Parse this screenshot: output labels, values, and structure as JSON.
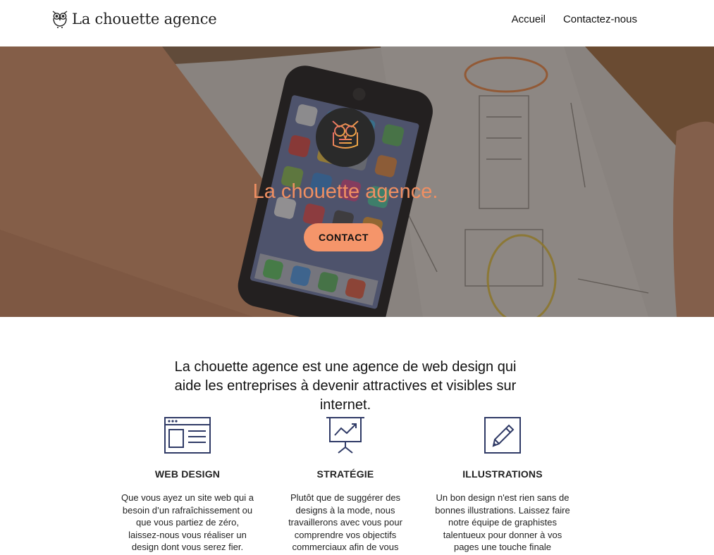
{
  "header": {
    "brand": "La chouette agence",
    "nav": [
      "Accueil",
      "Contactez-nous"
    ]
  },
  "hero": {
    "title": "La chouette agence.",
    "cta": "CONTACT"
  },
  "intro": {
    "text": "La chouette agence est une agence de web design qui aide les entreprises à devenir attractives et visibles sur internet."
  },
  "services": [
    {
      "icon": "web-design-icon",
      "title": "WEB DESIGN",
      "text": "Que vous ayez un site web qui a besoin d’un rafraîchissement ou que vous partiez de zéro, laissez-nous vous réaliser un design dont vous serez fier."
    },
    {
      "icon": "strategy-icon",
      "title": "STRATÉGIE",
      "text": "Plutôt que de suggérer des designs à la mode, nous travaillerons avec vous pour comprendre vos objectifs commerciaux afin de vous proposer le meilleur design possible."
    },
    {
      "icon": "pencil-icon",
      "title": "ILLUSTRATIONS",
      "text": "Un bon design n'est rien sans de bonnes illustrations. Laissez faire notre équipe de graphistes talentueux pour donner à vos pages une touche finale d'élégance."
    }
  ],
  "colors": {
    "accent": "#f5956a",
    "hero_title": "#f08f62",
    "icon_navy": "#2f3a66"
  }
}
